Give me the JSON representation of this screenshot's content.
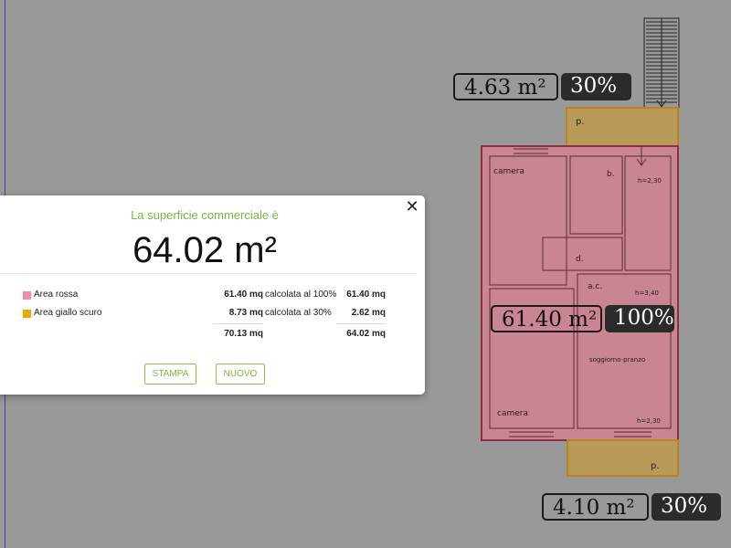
{
  "colors": {
    "background": "#999999",
    "area_red": "#c98593",
    "area_red_border": "#8a3040",
    "area_yellow": "#b99a58",
    "area_yellow_border": "#b8861a",
    "swatch_red": "#f08ca0",
    "swatch_yellow": "#f0a800",
    "accent_green": "#7cb342"
  },
  "floorplan": {
    "rooms": {
      "camera_top": "camera",
      "bathroom": "b.",
      "height_top": "h=2,30",
      "hall": "d.",
      "ac": "a.c.",
      "height_mid": "h=3,40",
      "living": "soggiorno-pranzo",
      "camera_bottom": "camera",
      "height_bottom": "h=2,30",
      "porch_top": "p.",
      "porch_bottom": "p."
    }
  },
  "badges": {
    "top": {
      "area": "4.63 m²",
      "percent": "30%"
    },
    "middle": {
      "area": "61.40 m²",
      "percent": "100%"
    },
    "bottom": {
      "area": "4.10 m²",
      "percent": "30%"
    }
  },
  "dialog": {
    "close_symbol": "✕",
    "subtitle": "La superficie commerciale è",
    "total": "64.02 m²",
    "rows": [
      {
        "label": "Area rossa",
        "mq": "61.40 mq",
        "calc": "calcolata al 100%",
        "result": "61.40 mq"
      },
      {
        "label": "Area giallo scuro",
        "mq": "8.73 mq",
        "calc": "calcolata al 30%",
        "result": "2.62 mq"
      }
    ],
    "totals": {
      "mq": "70.13 mq",
      "result": "64.02 mq"
    },
    "buttons": {
      "print": "STAMPA",
      "new": "NUOVO"
    }
  }
}
